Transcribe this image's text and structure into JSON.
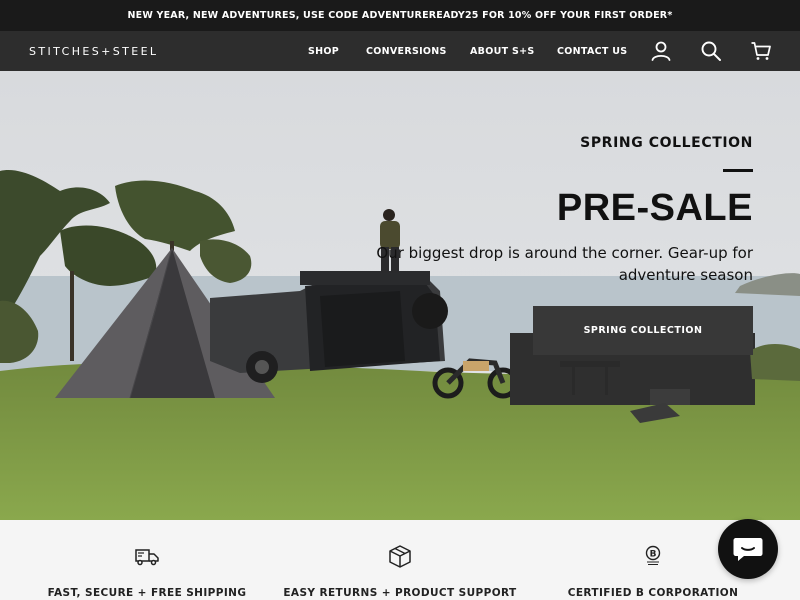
{
  "announcement": {
    "text": "NEW YEAR, NEW ADVENTURES, USE CODE ADVENTUREREADY25 FOR 10% OFF YOUR FIRST ORDER*"
  },
  "header": {
    "logo": "STITCHES+STEEL",
    "nav": [
      {
        "label": "SHOP"
      },
      {
        "label": "CONVERSIONS"
      },
      {
        "label": "ABOUT S+S"
      },
      {
        "label": "CONTACT US"
      }
    ],
    "icons": [
      "account-icon",
      "search-icon",
      "cart-icon"
    ]
  },
  "hero": {
    "eyebrow": "SPRING COLLECTION",
    "title": "PRE-SALE",
    "subtitle": "Our biggest drop is around the corner. Gear-up for adventure season",
    "cta": "SPRING COLLECTION"
  },
  "features": [
    {
      "icon": "truck-icon",
      "label": "FAST, SECURE + FREE SHIPPING"
    },
    {
      "icon": "box-icon",
      "label": "EASY RETURNS + PRODUCT SUPPORT"
    },
    {
      "icon": "b-corp-icon",
      "label": "CERTIFIED B CORPORATION"
    }
  ],
  "chat": {
    "icon": "chat-icon"
  },
  "colors": {
    "announcement_bg": "#1a1a1a",
    "nav_bg": "#2d2d2d",
    "button_bg": "#383838",
    "chat_bg": "#111111"
  }
}
